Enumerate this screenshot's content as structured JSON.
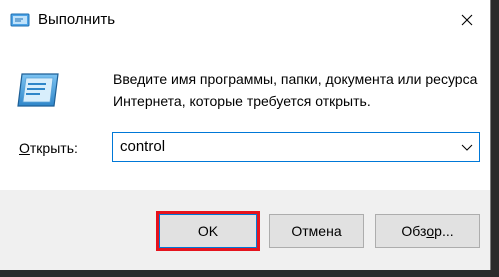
{
  "window": {
    "title": "Выполнить"
  },
  "dialog": {
    "description": "Введите имя программы, папки, документа или ресурса Интернета, которые требуется открыть.",
    "open_label_prefix": "",
    "open_label_access_key": "О",
    "open_label_rest": "ткрыть:",
    "input_value": "control"
  },
  "buttons": {
    "ok_label": "OK",
    "cancel_label": "Отмена",
    "browse_label_prefix": "Обз",
    "browse_label_access_key": "о",
    "browse_label_rest": "р..."
  },
  "icons": {
    "title": "run-icon",
    "main": "run-icon",
    "close": "close-icon",
    "dropdown": "chevron-down-icon"
  },
  "colors": {
    "focus_border": "#0078d7",
    "highlight": "#e5141e",
    "footer_bg": "#f0f0f0",
    "button_bg": "#e1e1e1"
  }
}
